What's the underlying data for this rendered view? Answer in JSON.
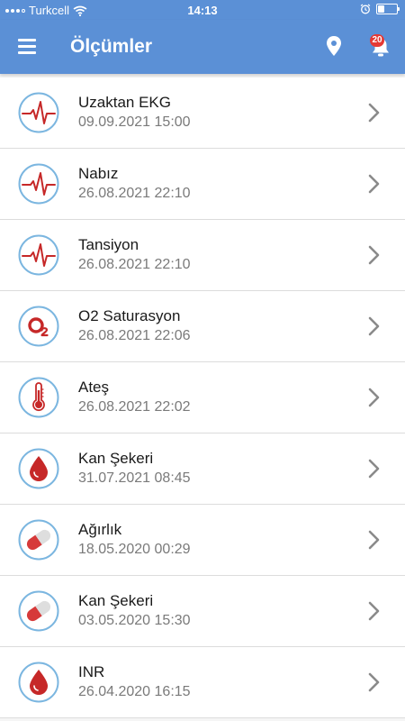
{
  "status_bar": {
    "carrier": "Turkcell",
    "time": "14:13",
    "battery_level": 0.35
  },
  "header": {
    "title": "Ölçümler",
    "notification_count": "20"
  },
  "colors": {
    "header_bg": "#5b90d6",
    "icon_red": "#c62828",
    "icon_ring": "#7bb6e0",
    "badge_red": "#e53935"
  },
  "measurements": [
    {
      "title": "Uzaktan EKG",
      "date": "09.09.2021 15:00",
      "icon": "heartbeat-icon"
    },
    {
      "title": "Nabız",
      "date": "26.08.2021 22:10",
      "icon": "heartbeat-icon"
    },
    {
      "title": "Tansiyon",
      "date": "26.08.2021 22:10",
      "icon": "heartbeat-icon"
    },
    {
      "title": "O2 Saturasyon",
      "date": "26.08.2021 22:06",
      "icon": "oxygen-icon"
    },
    {
      "title": "Ateş",
      "date": "26.08.2021 22:02",
      "icon": "thermometer-icon"
    },
    {
      "title": "Kan Şekeri",
      "date": "31.07.2021 08:45",
      "icon": "blood-drop-icon"
    },
    {
      "title": "Ağırlık",
      "date": "18.05.2020 00:29",
      "icon": "pill-icon"
    },
    {
      "title": "Kan Şekeri",
      "date": "03.05.2020 15:30",
      "icon": "pill-icon"
    },
    {
      "title": "INR",
      "date": "26.04.2020 16:15",
      "icon": "blood-drop-icon"
    }
  ]
}
